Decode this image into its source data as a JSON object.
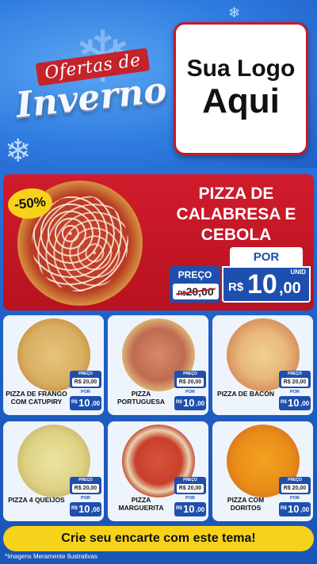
{
  "header": {
    "banner_line1": "Ofertas de",
    "banner_line2": "Inverno",
    "logo_line1": "Sua Logo",
    "logo_line2": "Aqui"
  },
  "featured": {
    "discount": "-50%",
    "title": "PIZZA DE CALABRESA E CEBOLA",
    "preco_label": "PREÇO",
    "old_currency": "R$",
    "old_price": "20,00",
    "por_label": "POR",
    "currency": "R$",
    "price_int": "10",
    "price_cents": ",00",
    "unit": "UNID"
  },
  "products": [
    {
      "name": "PIZZA DE FRANGO COM CATUPIRY",
      "preco_label": "PREÇO",
      "old_price": "R$ 20,00",
      "por_label": "POR",
      "currency": "R$",
      "price_int": "10",
      "price_cents": ",00"
    },
    {
      "name": "PIZZA PORTUGUESA",
      "preco_label": "PREÇO",
      "old_price": "R$ 20,00",
      "por_label": "POR",
      "currency": "R$",
      "price_int": "10",
      "price_cents": ",00"
    },
    {
      "name": "PIZZA DE BACON",
      "preco_label": "PREÇO",
      "old_price": "R$ 20,00",
      "por_label": "POR",
      "currency": "R$",
      "price_int": "10",
      "price_cents": ",00"
    },
    {
      "name": "PIZZA 4 QUEIJOS",
      "preco_label": "PREÇO",
      "old_price": "R$ 20,00",
      "por_label": "POR",
      "currency": "R$",
      "price_int": "10",
      "price_cents": ",00"
    },
    {
      "name": "PIZZA MARGUERITA",
      "preco_label": "PREÇO",
      "old_price": "R$ 20,00",
      "por_label": "POR",
      "currency": "R$",
      "price_int": "10",
      "price_cents": ",00"
    },
    {
      "name": "PIZZA COM DORITOS",
      "preco_label": "PREÇO",
      "old_price": "R$ 20,00",
      "por_label": "POR",
      "currency": "R$",
      "price_int": "10",
      "price_cents": ",00"
    }
  ],
  "cta": "Crie seu encarte com este tema!",
  "disclaimer": "*Imagens Meramente Ilustrativas",
  "colors": {
    "accent_red": "#c8182a",
    "accent_blue": "#1e4fae",
    "accent_yellow": "#f7d21b"
  }
}
